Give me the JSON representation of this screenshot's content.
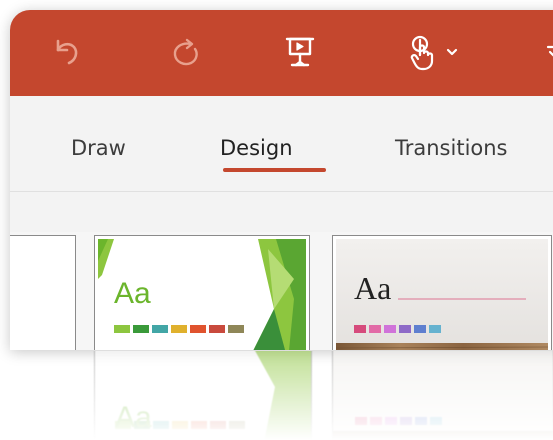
{
  "quick_access_toolbar": {
    "background": "#c4472e",
    "buttons": [
      {
        "icon": "undo-icon"
      },
      {
        "icon": "redo-icon"
      },
      {
        "icon": "present-from-beginning-icon"
      },
      {
        "icon": "touch-mouse-mode-icon",
        "dropdown_icon": "chevron-down-icon"
      },
      {
        "icon": "customize-toolbar-icon"
      }
    ]
  },
  "ribbon": {
    "tabs": [
      {
        "label": "Draw",
        "active": false
      },
      {
        "label": "Design",
        "active": true
      },
      {
        "label": "Transitions",
        "active": false
      }
    ],
    "accent": "#c4472e"
  },
  "themes_gallery": {
    "thumbnails": [
      {
        "name": "partial-theme",
        "sample_text": ""
      },
      {
        "name": "facet-theme",
        "sample_text": "Aa",
        "text_color": "#6bb52c",
        "swatches": [
          "#8dc63f",
          "#3a9a3a",
          "#42a6a6",
          "#e0b12d",
          "#e0532e",
          "#c94a3d",
          "#8f8758"
        ]
      },
      {
        "name": "wood-type-theme",
        "sample_text": "Aa",
        "text_color": "#222222",
        "swatches": [
          "#d64b7c",
          "#e26aa6",
          "#d073d9",
          "#8e6ac7",
          "#5f7fcf",
          "#66b2cf"
        ]
      }
    ]
  }
}
